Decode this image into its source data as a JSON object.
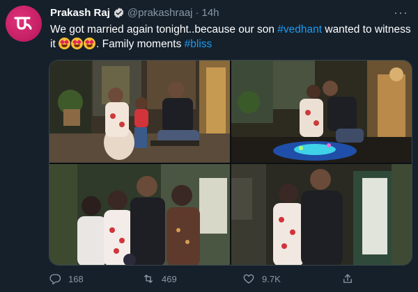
{
  "tweet": {
    "author_name": "Prakash Raj",
    "author_handle": "@prakashraaj",
    "separator": "·",
    "time": "14h",
    "avatar_letter": "ಪ್ರ",
    "text": {
      "part1": "We got married again tonight..because our son ",
      "hashtag1": "#vedhant",
      "part2": " wanted to witness it ",
      "emoji_name": "smiling-face-with-heart-eyes",
      "emoji_count": 3,
      "part3": ". Family moments ",
      "hashtag2": "#bliss"
    },
    "photos": [
      {
        "name": "photo-1",
        "alt": "couple seated on swing with child"
      },
      {
        "name": "photo-2",
        "alt": "couple kissing on swing with lights"
      },
      {
        "name": "photo-3",
        "alt": "family group photo"
      },
      {
        "name": "photo-4",
        "alt": "couple embracing"
      }
    ],
    "actions": {
      "reply_count": "168",
      "retweet_count": "469",
      "like_count": "9.7K",
      "reply_icon": "reply-icon",
      "retweet_icon": "retweet-icon",
      "like_icon": "heart-icon",
      "share_icon": "share-icon"
    }
  },
  "colors": {
    "background": "#15202b",
    "text": "#ffffff",
    "muted": "#8b98a5",
    "link": "#1d9bf0",
    "avatar": "#d81f6e",
    "border": "#38444d"
  }
}
